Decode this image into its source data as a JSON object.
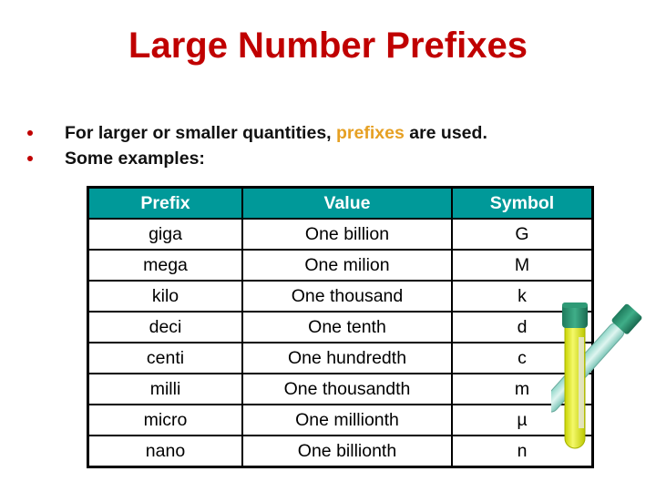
{
  "slide": {
    "title": "Large Number Prefixes",
    "bullets": [
      {
        "text_before": "For larger or smaller quantities, ",
        "highlight": "prefixes",
        "text_after": " are used."
      },
      {
        "text_before": "Some examples:",
        "highlight": "",
        "text_after": ""
      }
    ],
    "colors": {
      "title": "#c00000",
      "bullet": "#c00000",
      "highlight": "#e6a023",
      "table_header_bg": "#009999",
      "table_header_text": "#ffffff"
    }
  },
  "table": {
    "headers": [
      "Prefix",
      "Value",
      "Symbol"
    ],
    "rows": [
      [
        "giga",
        "One billion",
        "G"
      ],
      [
        "mega",
        "One milion",
        "M"
      ],
      [
        "kilo",
        "One thousand",
        "k"
      ],
      [
        "deci",
        "One tenth",
        "d"
      ],
      [
        "centi",
        "One hundredth",
        "c"
      ],
      [
        "milli",
        "One thousandth",
        "m"
      ],
      [
        "micro",
        "One millionth",
        "µ"
      ],
      [
        "nano",
        "One billionth",
        "n"
      ]
    ]
  },
  "illustration": {
    "icon": "test-tubes-icon"
  }
}
